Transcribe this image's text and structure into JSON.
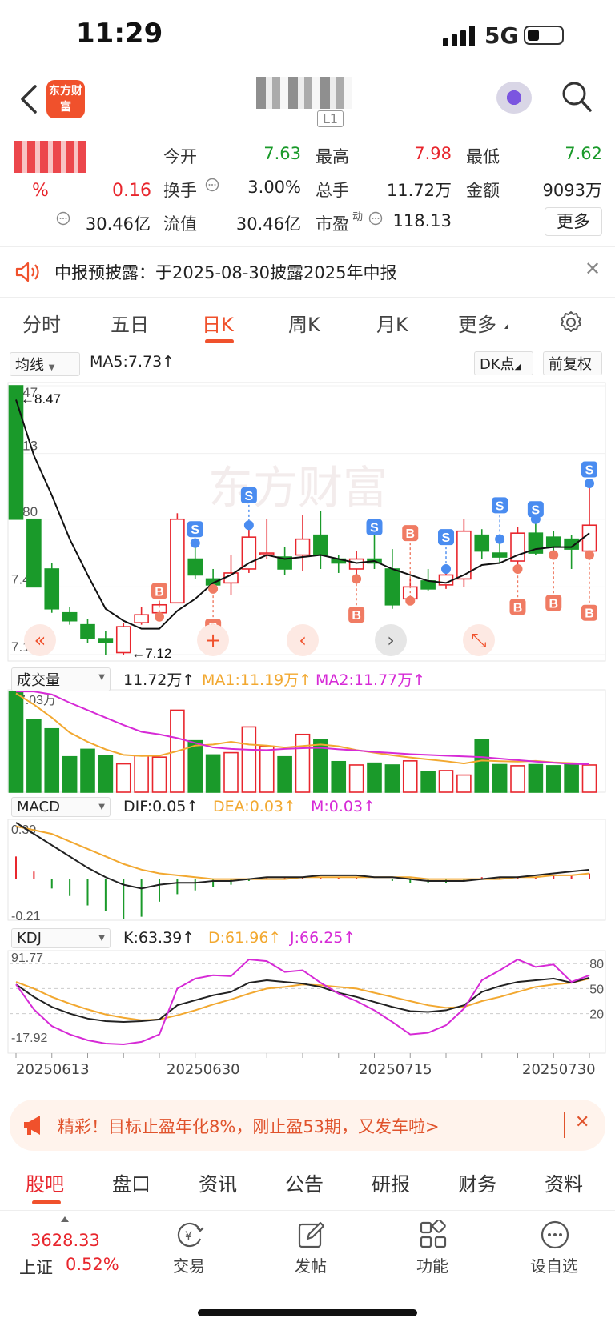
{
  "status_bar": {
    "time": "11:29",
    "network": "5G"
  },
  "header": {
    "logo_text": "东方财富",
    "stock_code_tag": "L1"
  },
  "quote": {
    "pct_change": "%",
    "change": "0.16",
    "open_label": "今开",
    "open_value": "7.63",
    "high_label": "最高",
    "high_value": "7.98",
    "low_label": "最低",
    "low_value": "7.62",
    "turnover_label": "换手",
    "turnover_value": "3.00%",
    "volume_label": "总手",
    "volume_value": "11.72万",
    "amount_label": "金额",
    "amount_value": "9093万",
    "mcap_value": "30.46亿",
    "float_label": "流值",
    "float_value": "30.46亿",
    "pe_label": "市盈",
    "pe_sup": "动",
    "pe_value": "118.13",
    "more_button": "更多"
  },
  "notice": {
    "text": "中报预披露：于2025-08-30披露2025年中报"
  },
  "tabs": [
    {
      "label": "分时"
    },
    {
      "label": "五日"
    },
    {
      "label": "日K"
    },
    {
      "label": "周K"
    },
    {
      "label": "月K"
    },
    {
      "label": "更多"
    }
  ],
  "kline": {
    "ma_select": "均线",
    "ma5_label": "MA5:7.73↑",
    "dk_button": "DK点",
    "adjust_button": "前复权",
    "y_ticks": [
      "8.47",
      "8.13",
      "7.80",
      "7.46",
      "7.12"
    ],
    "max_label": "←8.47",
    "min_label": "←7.12",
    "watermark": "东方财富"
  },
  "volume": {
    "select": "成交量",
    "value_label": "11.72万↑",
    "ma1_label": "MA1:11.19万↑",
    "ma2_label": "MA2:11.77万↑",
    "top_tick": "27.03万"
  },
  "macd": {
    "select": "MACD",
    "dif_label": "DIF:0.05↑",
    "dea_label": "DEA:0.03↑",
    "m_label": "M:0.03↑",
    "top_tick": "0.30",
    "bottom_tick": "-0.21"
  },
  "kdj": {
    "select": "KDJ",
    "k_label": "K:63.39↑",
    "d_label": "D:61.96↑",
    "j_label": "J:66.25↑",
    "top_tick": "91.77",
    "bottom_tick": "-17.92",
    "right_ticks": [
      "80",
      "50",
      "20"
    ]
  },
  "x_dates": [
    "20250613",
    "20250630",
    "20250715",
    "20250730"
  ],
  "colors": {
    "up": "#e8262d",
    "down": "#1a9a2a",
    "accent": "#f0512c",
    "ma1": "#f2a830",
    "ma2": "#d62ad6"
  },
  "chart_data": {
    "type": "candlestick",
    "ohlc": [
      [
        8.47,
        7.8,
        8.47,
        7.8
      ],
      [
        7.8,
        7.46,
        7.8,
        7.46
      ],
      [
        7.55,
        7.35,
        7.58,
        7.33
      ],
      [
        7.33,
        7.29,
        7.36,
        7.27
      ],
      [
        7.27,
        7.2,
        7.3,
        7.18
      ],
      [
        7.2,
        7.18,
        7.24,
        7.12
      ],
      [
        7.13,
        7.26,
        7.28,
        7.12
      ],
      [
        7.28,
        7.32,
        7.36,
        7.27
      ],
      [
        7.33,
        7.37,
        7.39,
        7.31
      ],
      [
        7.38,
        7.8,
        7.83,
        7.38
      ],
      [
        7.6,
        7.52,
        7.68,
        7.5
      ],
      [
        7.5,
        7.47,
        7.55,
        7.45
      ],
      [
        7.48,
        7.53,
        7.62,
        7.42
      ],
      [
        7.55,
        7.71,
        7.77,
        7.53
      ],
      [
        7.63,
        7.63,
        7.8,
        7.6
      ],
      [
        7.61,
        7.55,
        7.66,
        7.52
      ],
      [
        7.62,
        7.7,
        7.82,
        7.54
      ],
      [
        7.72,
        7.62,
        7.84,
        7.55
      ],
      [
        7.6,
        7.58,
        7.62,
        7.53
      ],
      [
        7.55,
        7.6,
        7.64,
        7.5
      ],
      [
        7.6,
        7.58,
        7.75,
        7.55
      ],
      [
        7.55,
        7.37,
        7.65,
        7.35
      ],
      [
        7.4,
        7.46,
        7.5,
        7.39
      ],
      [
        7.49,
        7.45,
        7.55,
        7.44
      ],
      [
        7.47,
        7.52,
        7.55,
        7.45
      ],
      [
        7.5,
        7.74,
        7.8,
        7.46
      ],
      [
        7.72,
        7.64,
        7.75,
        7.6
      ],
      [
        7.63,
        7.61,
        7.7,
        7.58
      ],
      [
        7.59,
        7.73,
        7.76,
        7.55
      ],
      [
        7.73,
        7.63,
        7.8,
        7.62
      ],
      [
        7.71,
        7.66,
        7.74,
        7.62
      ],
      [
        7.7,
        7.65,
        7.72,
        7.55
      ],
      [
        7.64,
        7.77,
        7.98,
        7.62
      ]
    ],
    "ma5": [
      8.4,
      8.12,
      7.92,
      7.7,
      7.52,
      7.35,
      7.29,
      7.25,
      7.25,
      7.34,
      7.4,
      7.48,
      7.52,
      7.58,
      7.62,
      7.6,
      7.61,
      7.62,
      7.6,
      7.58,
      7.59,
      7.55,
      7.52,
      7.49,
      7.48,
      7.52,
      7.57,
      7.58,
      7.62,
      7.65,
      7.66,
      7.66,
      7.73
    ],
    "volume": [
      27.0,
      19.5,
      17.0,
      9.5,
      11.5,
      9.8,
      7.6,
      9.8,
      9.4,
      22.0,
      13.8,
      10.0,
      10.6,
      17.5,
      12.3,
      9.5,
      15.5,
      14.0,
      8.2,
      7.3,
      7.8,
      7.3,
      8.4,
      5.5,
      5.8,
      4.6,
      14.0,
      7.4,
      7.1,
      7.4,
      7.1,
      7.6,
      7.3
    ],
    "vol_ma1": [
      26.5,
      23.5,
      20.0,
      16.0,
      13.5,
      11.5,
      10.0,
      9.7,
      9.8,
      11.0,
      12.5,
      12.8,
      13.5,
      12.8,
      12.5,
      12.0,
      12.4,
      12.8,
      12.3,
      11.3,
      10.6,
      9.9,
      9.3,
      8.8,
      8.3,
      7.7,
      8.5,
      8.3,
      8.2,
      8.4,
      8.0,
      7.8,
      7.6
    ],
    "vol_ma2": [
      27.0,
      27.0,
      26.2,
      24.0,
      22.0,
      20.0,
      18.0,
      16.2,
      15.5,
      14.5,
      13.2,
      12.0,
      11.6,
      11.4,
      11.3,
      11.6,
      11.8,
      11.9,
      11.5,
      11.2,
      10.8,
      10.5,
      10.2,
      10.0,
      9.8,
      9.6,
      9.4,
      9.0,
      8.6,
      8.2,
      7.9,
      7.6,
      7.5
    ],
    "macd_dif": [
      0.3,
      0.24,
      0.18,
      0.12,
      0.06,
      0.01,
      -0.03,
      -0.05,
      -0.03,
      -0.02,
      -0.02,
      -0.01,
      -0.01,
      0.0,
      0.01,
      0.01,
      0.01,
      0.02,
      0.02,
      0.02,
      0.01,
      0.01,
      0.0,
      -0.01,
      -0.01,
      -0.01,
      0.0,
      0.01,
      0.01,
      0.02,
      0.03,
      0.04,
      0.05
    ],
    "macd_dea": [
      0.28,
      0.26,
      0.24,
      0.2,
      0.16,
      0.12,
      0.08,
      0.05,
      0.03,
      0.02,
      0.01,
      0.0,
      0.0,
      0.0,
      0.0,
      0.0,
      0.01,
      0.01,
      0.01,
      0.01,
      0.01,
      0.01,
      0.01,
      0.0,
      0.0,
      0.0,
      0.0,
      0.0,
      0.01,
      0.01,
      0.02,
      0.02,
      0.03
    ],
    "macd_m": [
      0.12,
      0.04,
      -0.05,
      -0.09,
      -0.14,
      -0.17,
      -0.21,
      -0.2,
      -0.12,
      -0.08,
      -0.06,
      -0.04,
      -0.03,
      -0.01,
      0.01,
      0.01,
      0.01,
      0.01,
      0.01,
      0.01,
      0.0,
      -0.01,
      -0.02,
      -0.02,
      -0.02,
      -0.01,
      0.01,
      0.01,
      0.01,
      0.01,
      0.02,
      0.02,
      0.03
    ],
    "kdj_k": [
      55,
      40,
      28,
      20,
      14,
      11,
      10,
      11,
      13,
      30,
      36,
      42,
      46,
      57,
      60,
      58,
      56,
      52,
      45,
      40,
      34,
      28,
      23,
      22,
      24,
      30,
      46,
      53,
      58,
      60,
      62,
      57,
      63
    ],
    "kdj_d": [
      58,
      50,
      40,
      32,
      25,
      19,
      15,
      12,
      13,
      18,
      24,
      31,
      37,
      44,
      50,
      52,
      55,
      54,
      52,
      50,
      45,
      40,
      35,
      30,
      27,
      28,
      35,
      40,
      46,
      52,
      55,
      57,
      62
    ],
    "kdj_j": [
      55,
      25,
      5,
      -5,
      -12,
      -16,
      -17,
      -14,
      -5,
      50,
      62,
      66,
      65,
      85,
      83,
      70,
      72,
      57,
      44,
      35,
      24,
      10,
      -5,
      -3,
      6,
      26,
      60,
      72,
      85,
      76,
      79,
      58,
      66
    ]
  },
  "promo": {
    "text": "精彩！目标止盈年化8%，刚止盈53期，又发车啦>"
  },
  "bottom_tabs": [
    {
      "label": "股吧"
    },
    {
      "label": "盘口"
    },
    {
      "label": "资讯"
    },
    {
      "label": "公告"
    },
    {
      "label": "研报"
    },
    {
      "label": "财务"
    },
    {
      "label": "资料"
    }
  ],
  "bottom_nav": {
    "index_value": "3628.33",
    "index_name": "上证",
    "index_pct": "0.52%",
    "items": [
      {
        "label": "交易"
      },
      {
        "label": "发帖"
      },
      {
        "label": "功能"
      },
      {
        "label": "设自选"
      }
    ]
  }
}
